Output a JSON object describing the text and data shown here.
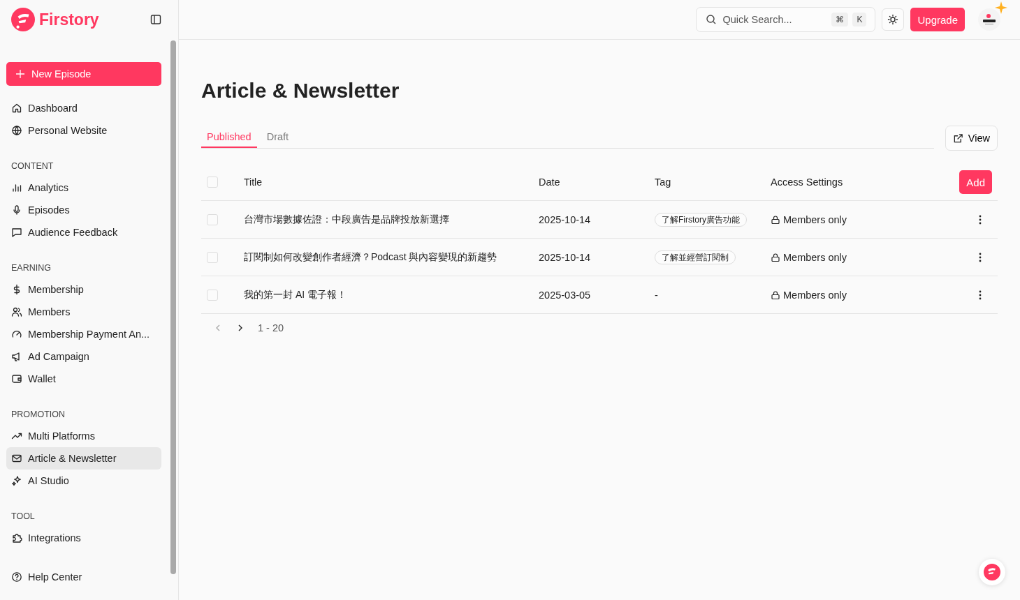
{
  "brand": {
    "name": "Firstory"
  },
  "sidebar": {
    "new_button": "New Episode",
    "groups": [
      {
        "items": [
          {
            "label": "Dashboard",
            "selected": false
          },
          {
            "label": "Personal Website",
            "selected": false
          }
        ]
      },
      {
        "heading": "CONTENT",
        "items": [
          {
            "label": "Analytics",
            "selected": false
          },
          {
            "label": "Episodes",
            "selected": false
          },
          {
            "label": "Audience Feedback",
            "selected": false
          }
        ]
      },
      {
        "heading": "EARNING",
        "items": [
          {
            "label": "Membership",
            "selected": false
          },
          {
            "label": "Members",
            "selected": false
          },
          {
            "label": "Membership Payment An...",
            "selected": false
          },
          {
            "label": "Ad Campaign",
            "selected": false
          },
          {
            "label": "Wallet",
            "selected": false
          }
        ]
      },
      {
        "heading": "PROMOTION",
        "items": [
          {
            "label": "Multi Platforms",
            "selected": false
          },
          {
            "label": "Article & Newsletter",
            "selected": true
          },
          {
            "label": "AI Studio",
            "selected": false
          }
        ]
      },
      {
        "heading": "TOOL",
        "items": [
          {
            "label": "Integrations",
            "selected": false
          }
        ]
      }
    ],
    "footer_item": "Help Center"
  },
  "topbar": {
    "search": {
      "placeholder": "Quick Search...",
      "keys": [
        "⌘",
        "K"
      ]
    },
    "upgrade_button": "Upgrade"
  },
  "page": {
    "title": "Article & Newsletter",
    "tabs": [
      {
        "label": "Published",
        "selected": true
      },
      {
        "label": "Draft",
        "selected": false
      }
    ],
    "view_button": "View",
    "table": {
      "columns": [
        "Title",
        "Date",
        "Tag",
        "Access Settings"
      ],
      "add_button": "Add",
      "all_checked": false,
      "rows": [
        {
          "checked": false,
          "title": "台灣市場數據佐證：中段廣告是品牌投放新選擇",
          "date": "2025-10-14",
          "tagged": true,
          "tag": "了解Firstory廣告功能",
          "access": "Members only"
        },
        {
          "checked": false,
          "title": "訂閱制如何改變創作者經濟？Podcast 與內容變現的新趨勢",
          "date": "2025-10-14",
          "tagged": true,
          "tag": "了解並經營訂閱制",
          "access": "Members only"
        },
        {
          "checked": false,
          "title": "我的第一封 AI 電子報！",
          "date": "2025-03-05",
          "tagged": false,
          "tag": "-",
          "access": "Members only"
        }
      ]
    },
    "pagination": {
      "prev_disabled": true,
      "next_disabled": false,
      "range": "1 - 20"
    }
  }
}
